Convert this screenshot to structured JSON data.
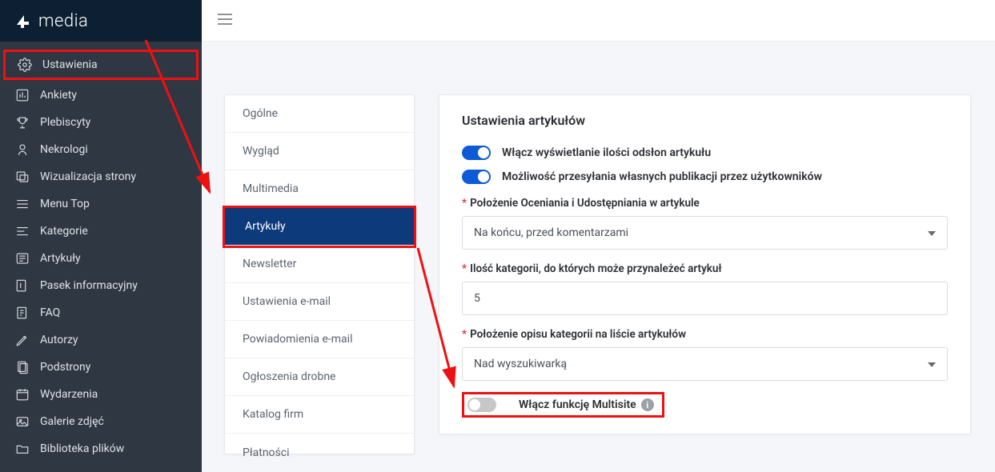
{
  "brand": "media",
  "sidebar": {
    "items": [
      {
        "label": "Ustawienia",
        "icon": "gear"
      },
      {
        "label": "Ankiety",
        "icon": "poll"
      },
      {
        "label": "Plebiscyty",
        "icon": "trophy"
      },
      {
        "label": "Nekrologi",
        "icon": "nekrologi"
      },
      {
        "label": "Wizualizacja strony",
        "icon": "layout"
      },
      {
        "label": "Menu Top",
        "icon": "menu"
      },
      {
        "label": "Kategorie",
        "icon": "categories"
      },
      {
        "label": "Artykuły",
        "icon": "news"
      },
      {
        "label": "Pasek informacyjny",
        "icon": "info-bar"
      },
      {
        "label": "FAQ",
        "icon": "faq"
      },
      {
        "label": "Autorzy",
        "icon": "pen"
      },
      {
        "label": "Podstrony",
        "icon": "pages"
      },
      {
        "label": "Wydarzenia",
        "icon": "calendar"
      },
      {
        "label": "Galerie zdjęć",
        "icon": "gallery"
      },
      {
        "label": "Biblioteka plików",
        "icon": "folder"
      }
    ]
  },
  "subnav": {
    "items": [
      "Ogólne",
      "Wygląd",
      "Multimedia",
      "Artykuły",
      "Newsletter",
      "Ustawienia e-mail",
      "Powiadomienia e-mail",
      "Ogłoszenia drobne",
      "Katalog firm",
      "Płatności"
    ],
    "active_index": 3
  },
  "panel": {
    "title": "Ustawienia artykułów",
    "toggle1": "Włącz wyświetlanie ilości odsłon artykułu",
    "toggle2": "Możliwość przesyłania własnych publikacji przez użytkowników",
    "field1_label": "Położenie Oceniania i Udostępniania w artykule",
    "field1_value": "Na końcu, przed komentarzami",
    "field2_label": "Ilość kategorii, do których może przynależeć artykuł",
    "field2_value": "5",
    "field3_label": "Położenie opisu kategorii na liście artykułów",
    "field3_value": "Nad wyszukiwarką",
    "toggle3": "Włącz funkcję Multisite"
  }
}
